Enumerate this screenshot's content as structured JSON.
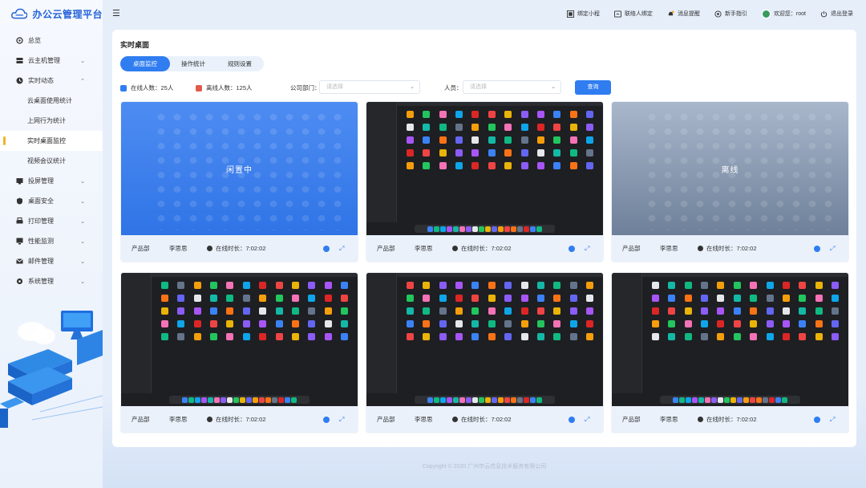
{
  "app": {
    "title": "办公云管理平台"
  },
  "sidebar": {
    "items": [
      {
        "label": "总览",
        "icon": "dashboard-icon",
        "chevron": ""
      },
      {
        "label": "云主机管理",
        "icon": "server-icon",
        "chevron": "⌄"
      },
      {
        "label": "实时动态",
        "icon": "activity-icon",
        "chevron": "⌃"
      },
      {
        "label": "云桌面使用统计",
        "sub": true
      },
      {
        "label": "上网行为统计",
        "sub": true
      },
      {
        "label": "实时桌面监控",
        "sub": true,
        "active": true
      },
      {
        "label": "视频会议统计",
        "sub": true
      },
      {
        "label": "投屏管理",
        "icon": "cast-icon",
        "chevron": "⌄"
      },
      {
        "label": "桌面安全",
        "icon": "shield-icon",
        "chevron": "⌄"
      },
      {
        "label": "打印管理",
        "icon": "printer-icon",
        "chevron": "⌄"
      },
      {
        "label": "性能监测",
        "icon": "monitor-icon",
        "chevron": "⌄"
      },
      {
        "label": "邮件管理",
        "icon": "mail-icon",
        "chevron": "⌄"
      },
      {
        "label": "系统管理",
        "icon": "settings-icon",
        "chevron": "⌄"
      }
    ]
  },
  "topbar": {
    "bind_mini": "绑定小程",
    "bind_person": "联络人绑定",
    "messages": "消息提醒",
    "guide": "新手指引",
    "welcome": "欢迎您：root",
    "logout": "退出登录"
  },
  "page": {
    "title": "实时桌面",
    "tabs": [
      "桌面监控",
      "操作统计",
      "规则设置"
    ],
    "online_label": "在线人数：25人",
    "offline_label": "离线人数：125人",
    "dept_label": "公司部门：",
    "dept_placeholder": "请选择",
    "person_label": "人员：",
    "person_placeholder": "请选择",
    "query_button": "查询"
  },
  "colors": {
    "online": "#2f7df0",
    "offline": "#e05a4b",
    "accent": "#2f7df0"
  },
  "cards": [
    {
      "state": "idle",
      "state_label": "闲置中",
      "dept": "产品部",
      "name": "李思思",
      "time": "在线时长：7:02:02"
    },
    {
      "state": "live",
      "state_label": "",
      "dept": "产品部",
      "name": "李思思",
      "time": "在线时长：7:02:02"
    },
    {
      "state": "offline",
      "state_label": "离线",
      "dept": "产品部",
      "name": "李思思",
      "time": "在线时长：7:02:02"
    },
    {
      "state": "live",
      "state_label": "",
      "dept": "产品部",
      "name": "李思思",
      "time": "在线时长：7:02:02"
    },
    {
      "state": "live",
      "state_label": "",
      "dept": "产品部",
      "name": "李思思",
      "time": "在线时长：7:02:02"
    },
    {
      "state": "live",
      "state_label": "",
      "dept": "产品部",
      "name": "李思思",
      "time": "在线时长：7:02:02"
    }
  ],
  "footer": {
    "copyright": "Copyright © 2020 广州市云信息技术服务有限公司"
  }
}
